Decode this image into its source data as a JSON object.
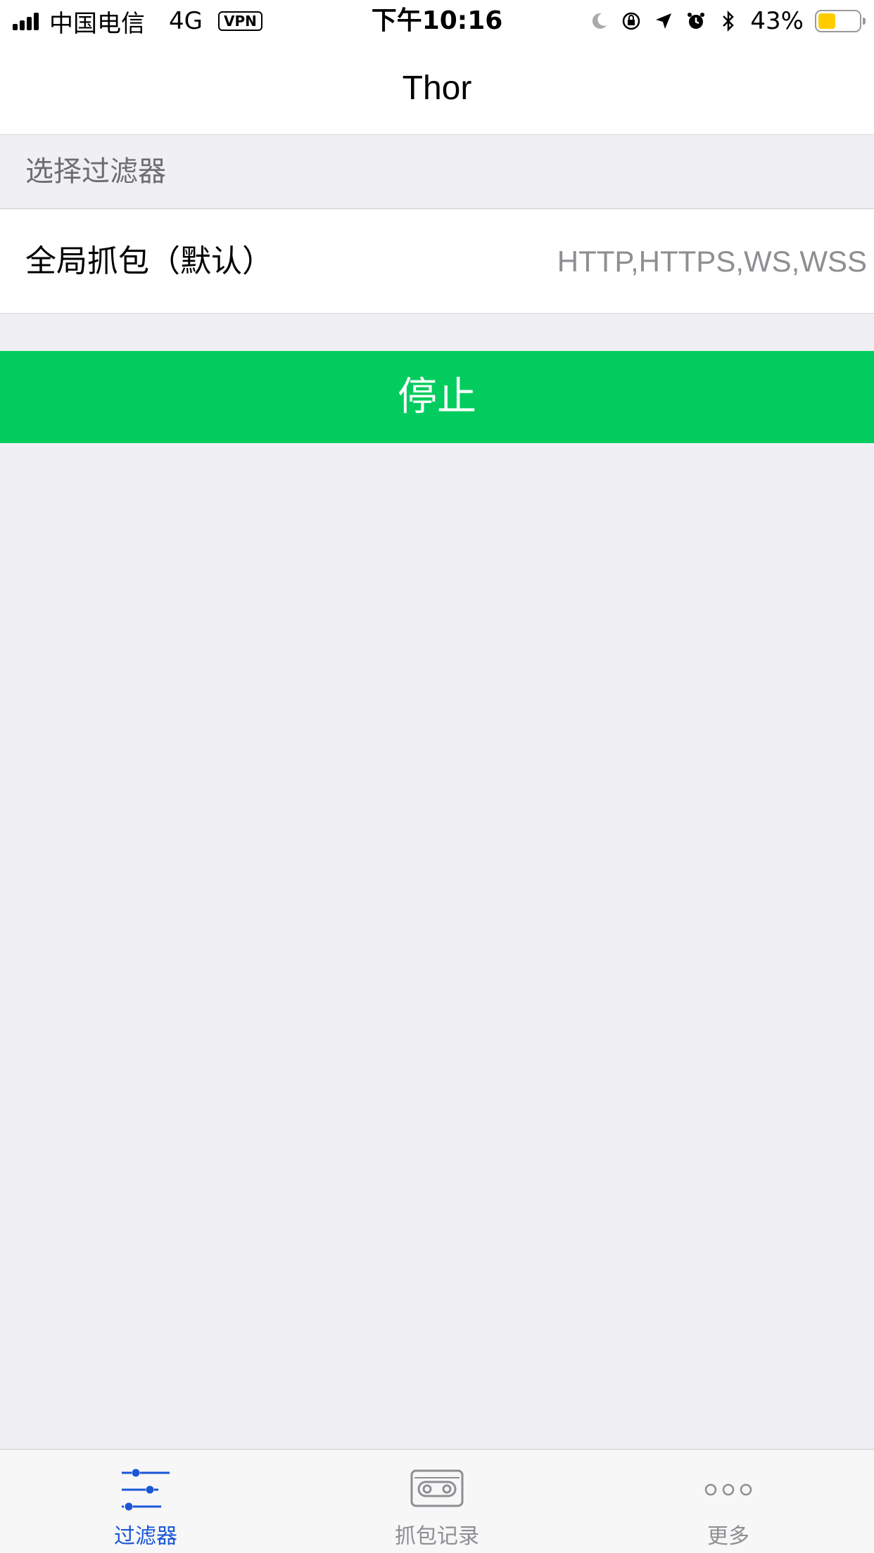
{
  "status_bar": {
    "carrier": "中国电信",
    "network": "4G",
    "vpn": "VPN",
    "time": "下午10:16",
    "battery_percent": "43%",
    "battery_level": 0.43,
    "icons": [
      "moon-icon",
      "rotation-lock-icon",
      "location-icon",
      "alarm-icon",
      "bluetooth-icon"
    ]
  },
  "nav": {
    "title": "Thor"
  },
  "section": {
    "header": "选择过滤器"
  },
  "filter": {
    "label": "全局抓包（默认）",
    "value": "HTTP,HTTPS,WS,WSS"
  },
  "action": {
    "stop_label": "停止"
  },
  "tabs": [
    {
      "label": "过滤器",
      "icon": "sliders-icon",
      "active": true
    },
    {
      "label": "抓包记录",
      "icon": "cassette-icon",
      "active": false
    },
    {
      "label": "更多",
      "icon": "more-dots-icon",
      "active": false
    }
  ],
  "colors": {
    "accent": "#1a56d6",
    "stop_button": "#03cc5e",
    "battery": "#ffcc00"
  }
}
